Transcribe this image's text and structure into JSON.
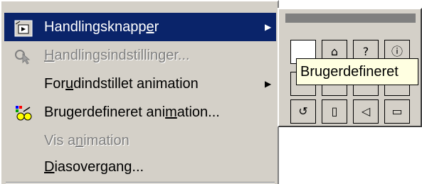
{
  "menu": {
    "items": [
      {
        "pre": "Handlingsknapp",
        "u": "e",
        "post": "r",
        "icon": "action-buttons-icon",
        "submenu_arrow": "▶"
      },
      {
        "pre": "",
        "u": "H",
        "post": "andlingsindstillinger...",
        "icon": "pointer-action-icon"
      },
      {
        "pre": "For",
        "u": "u",
        "post": "dindstillet animation",
        "icon": "",
        "submenu_arrow": "▶"
      },
      {
        "pre": "Brugerdefineret ani",
        "u": "m",
        "post": "ation...",
        "icon": "custom-animation-icon"
      },
      {
        "pre": "Vis a",
        "u": "n",
        "post": "imation",
        "icon": ""
      },
      {
        "pre": "",
        "u": "D",
        "post": "iasovergang...",
        "icon": ""
      }
    ]
  },
  "toolbar": {
    "buttons": [
      {
        "name": "custom-button",
        "glyph": ""
      },
      {
        "name": "home-button",
        "glyph": "⌂"
      },
      {
        "name": "help-button",
        "glyph": "?"
      },
      {
        "name": "information-button",
        "glyph": "ⓘ"
      },
      {
        "name": "back-button",
        "glyph": ""
      },
      {
        "name": "forward-button",
        "glyph": ""
      },
      {
        "name": "beginning-button",
        "glyph": ""
      },
      {
        "name": "end-button",
        "glyph": ""
      },
      {
        "name": "return-button",
        "glyph": "↺"
      },
      {
        "name": "document-button",
        "glyph": "▯"
      },
      {
        "name": "sound-button",
        "glyph": "◁"
      },
      {
        "name": "movie-button",
        "glyph": "▭"
      }
    ],
    "tooltip": "Brugerdefineret"
  }
}
